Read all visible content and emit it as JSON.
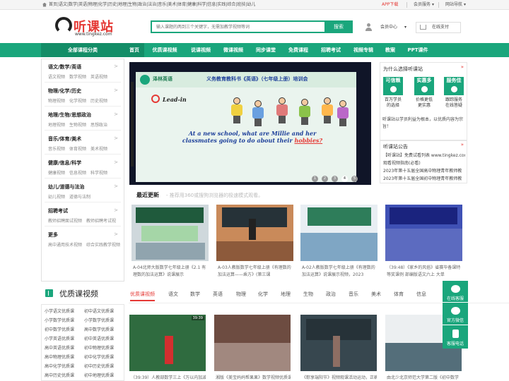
{
  "topbar": {
    "links": "首页|语文|数学|英语|物理|化学|历史|地理|生物|政治|法治|音乐|美术|体育|健康|科学|信息|实践|综合|班技|幼儿",
    "app": "APP下载",
    "service": "会员服务",
    "site_nav": "网站导航"
  },
  "logo": {
    "name": "听课站",
    "url": "www.tingkez.com"
  },
  "search": {
    "placeholder": "输入课题的两到三个关键字，无需加教学视频等词",
    "button": "搜索"
  },
  "header": {
    "member": "会员中心",
    "online": "在线支付"
  },
  "nav": {
    "all": "全部课程分类",
    "items": [
      "首页",
      "优质课视频",
      "说课视频",
      "微课视频",
      "同步课堂",
      "免费课程",
      "招聘考试",
      "视频专辑",
      "教案",
      "PPT课件"
    ]
  },
  "categories": [
    {
      "title": "语文/数学/英语",
      "subs": "语文视频　数学视频　英语视频"
    },
    {
      "title": "物理/化学/历史",
      "subs": "物理视频　化学视频　历史视频"
    },
    {
      "title": "地理/生物/思想政治",
      "subs": "地理视频　生物视频　思想政治"
    },
    {
      "title": "音乐/体育/美术",
      "subs": "音乐视频　体育视频　美术视频"
    },
    {
      "title": "健康/信息/科学",
      "subs": "健康视频　信息视频　科学视频"
    },
    {
      "title": "幼儿/道德与法治",
      "subs": "幼儿视频　道德与法制"
    },
    {
      "title": "招聘考试",
      "subs": "教师招聘面试视频　教师招聘考试视"
    },
    {
      "title": "更多",
      "subs": "高中通用技术视频　综合实践教学视频"
    }
  ],
  "banner": {
    "brand": "泽林英语",
    "title": "义务教育教科书《英语》（七年级上册）培训会",
    "lead": "Lead-in",
    "question_a": "At a new school, what are Millie and her",
    "question_b": "classmates going to do about their ",
    "question_c": "hobbies?",
    "dots": [
      "1",
      "2",
      "3",
      "4",
      "5"
    ]
  },
  "recent": {
    "title": "最近更新",
    "subtitle": "- 推荐用360或搜狗浏览器的极速模式观看。",
    "cards": [
      {
        "caption": "A-04北师大版数学七年级上册《2.1 有理数的加法运算》说课展示"
      },
      {
        "caption": "A-03人教版数学七年级上册《有理数的加法运算——乘方》(第三课"
      },
      {
        "caption": "A-02人教版数学七年级上册《有理数的加法运算》说课展示视频，2023"
      },
      {
        "caption": "（39:48）《家乡的风俗》省赛毕备课特等奖课例 部编版语文六上 大单"
      }
    ]
  },
  "why": {
    "title": "为什么选择听课站",
    "arrow": "»",
    "features": [
      {
        "badge": "可信赖",
        "label_a": "百万学员",
        "label_b": "的选择"
      },
      {
        "badge": "实惠多",
        "label_a": "价格更低",
        "label_b": "更实惠"
      },
      {
        "badge": "服务佳",
        "label_a": "跟踪服务",
        "label_b": "在线答疑"
      }
    ],
    "text": "听课站以学员利益为根本，以优质内容为宗旨！"
  },
  "notice": {
    "title": "听课站公告",
    "arrow": "»",
    "lines": [
      "【听课站】免费试看列表 www.tingkez.com",
      "观看视频指南(必看)",
      "2023年第十五届全国高中物理青年教师教",
      "2023年第十五届全国初中物理青年教师教"
    ]
  },
  "quality": {
    "title": "优质课视频",
    "tabs": [
      "优质课视频",
      "语文",
      "数学",
      "英语",
      "物理",
      "化学",
      "地理",
      "生物",
      "政治",
      "音乐",
      "美术",
      "体育",
      "信息"
    ],
    "list": [
      "小学语文优质课",
      "初中语文优质课",
      "小学数学优质课",
      "小学数学优质课",
      "初中数学优质课",
      "高中数学优质课",
      "小学英语优质课",
      "初中英语优质课",
      "高中英语优质课",
      "初中物理优质课",
      "高中物理优质课",
      "初中化学优质课",
      "高中化学优质课",
      "初中历史优质课",
      "高中历史优质课",
      "初中地理优质课"
    ],
    "videos": [
      {
        "duration": "39:39",
        "caption": "（39:39）人教部数学三上《万以内加减"
      },
      {
        "duration": "",
        "caption": "湘版《美宝妈妈帮果果》数学视频优质课"
      },
      {
        "duration": "",
        "caption": "《粽享端阳节》视频观课活动运动，正确"
      },
      {
        "duration": "",
        "caption": "由北少北京师范大学第二版《初中数学"
      }
    ]
  },
  "float": [
    "在线客服",
    "官方微信",
    "客服电话"
  ],
  "colors": {
    "brand_green": "#1aa67c",
    "dark_green": "#138d67",
    "accent_red": "#e53935"
  }
}
